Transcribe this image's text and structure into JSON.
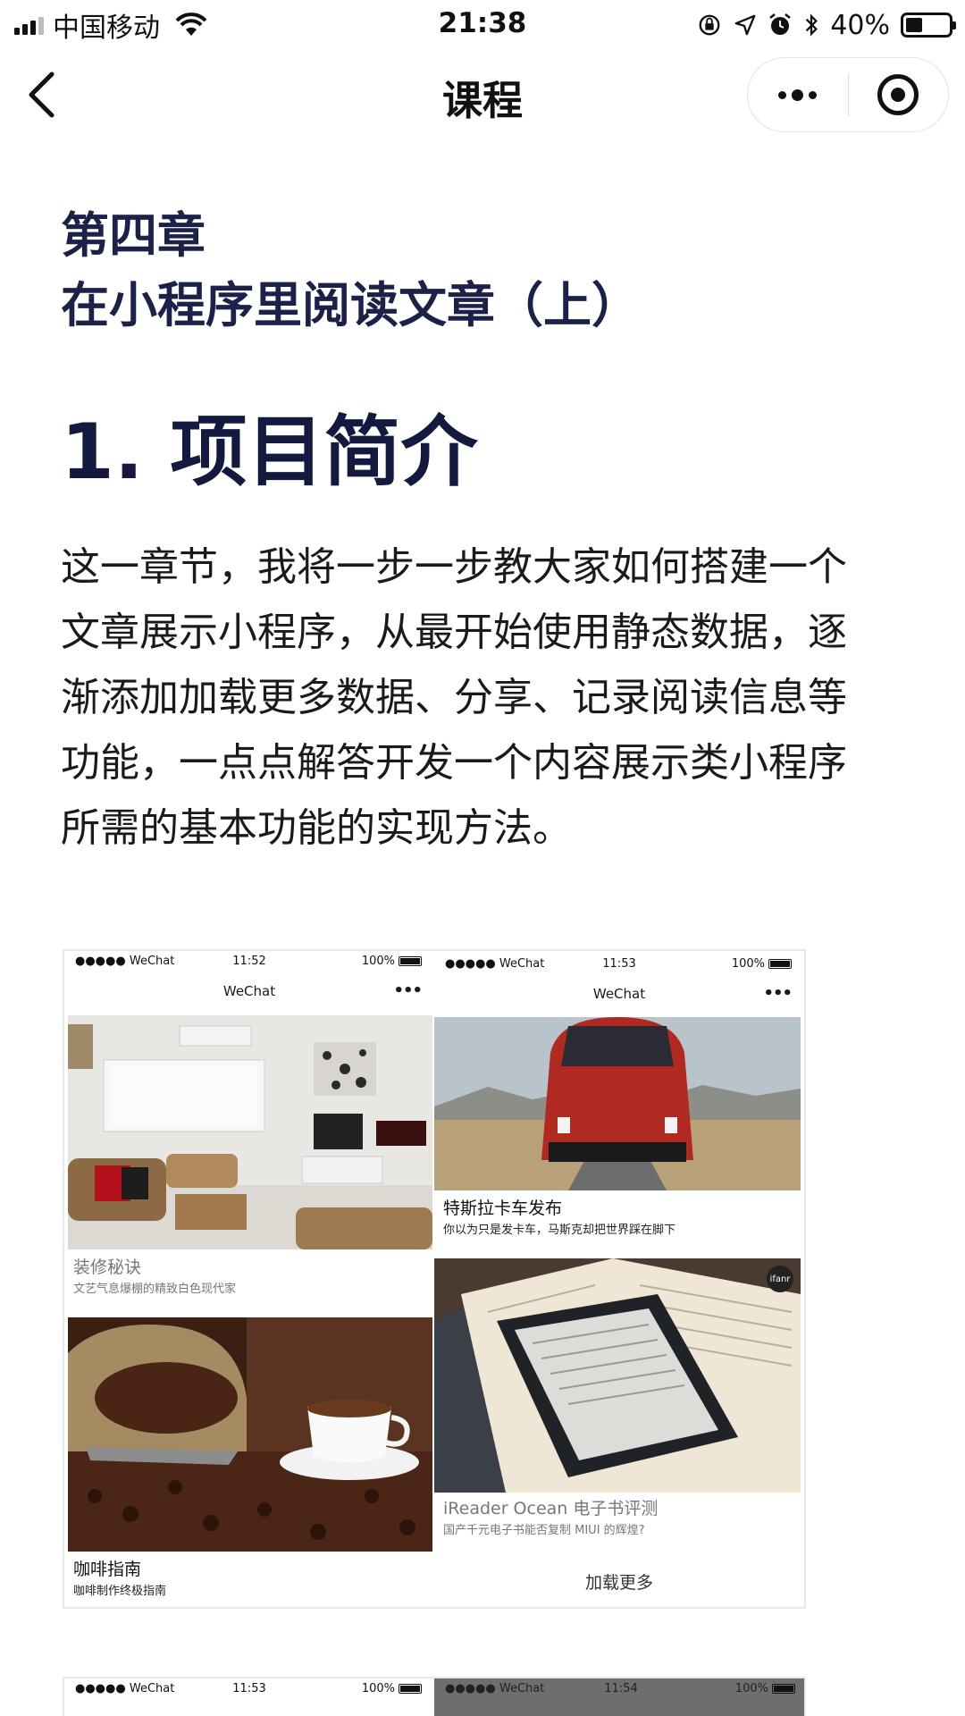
{
  "status_bar": {
    "carrier": "中国移动",
    "time": "21:38",
    "battery_percent": "40%",
    "battery_level": 0.4
  },
  "nav": {
    "title": "课程"
  },
  "article": {
    "chapter_label": "第四章",
    "chapter_title": "在小程序里阅读文章（上）",
    "section_heading": "1. 项目简介",
    "paragraph": "这一章节，我将一步一步教大家如何搭建一个文章展示小程序，从最开始使用静态数据，逐渐添加加载更多数据、分享、记录阅读信息等功能，一点点解答开发一个内容展示类小程序所需的基本功能的实现方法。"
  },
  "screenshot_1": {
    "left_phone": {
      "status_left": "●●●●● WeChat",
      "status_time": "11:52",
      "status_batt": "100%",
      "nav_title": "WeChat",
      "nav_more": "•••",
      "cards": [
        {
          "title": "装修秘诀",
          "subtitle": "文艺气息爆棚的精致白色现代家"
        },
        {
          "title": "咖啡指南",
          "subtitle": "咖啡制作终极指南"
        }
      ]
    },
    "right_phone": {
      "status_left": "●●●●● WeChat",
      "status_time": "11:53",
      "status_batt": "100%",
      "nav_title": "WeChat",
      "nav_more": "•••",
      "cards": [
        {
          "title": "特斯拉卡车发布",
          "subtitle": "你以为只是发卡车，马斯克却把世界踩在脚下"
        },
        {
          "title": "iReader Ocean 电子书评测",
          "subtitle": "国产千元电子书能否复制 MIUI 的辉煌?",
          "badge": "ifanr"
        }
      ],
      "load_more": "加载更多"
    }
  },
  "screenshot_2": {
    "left_status": {
      "left": "●●●●● WeChat",
      "time": "11:53",
      "batt": "100%"
    },
    "right_status": {
      "left": "●●●●● WeChat",
      "time": "11:54",
      "batt": "100%"
    }
  }
}
